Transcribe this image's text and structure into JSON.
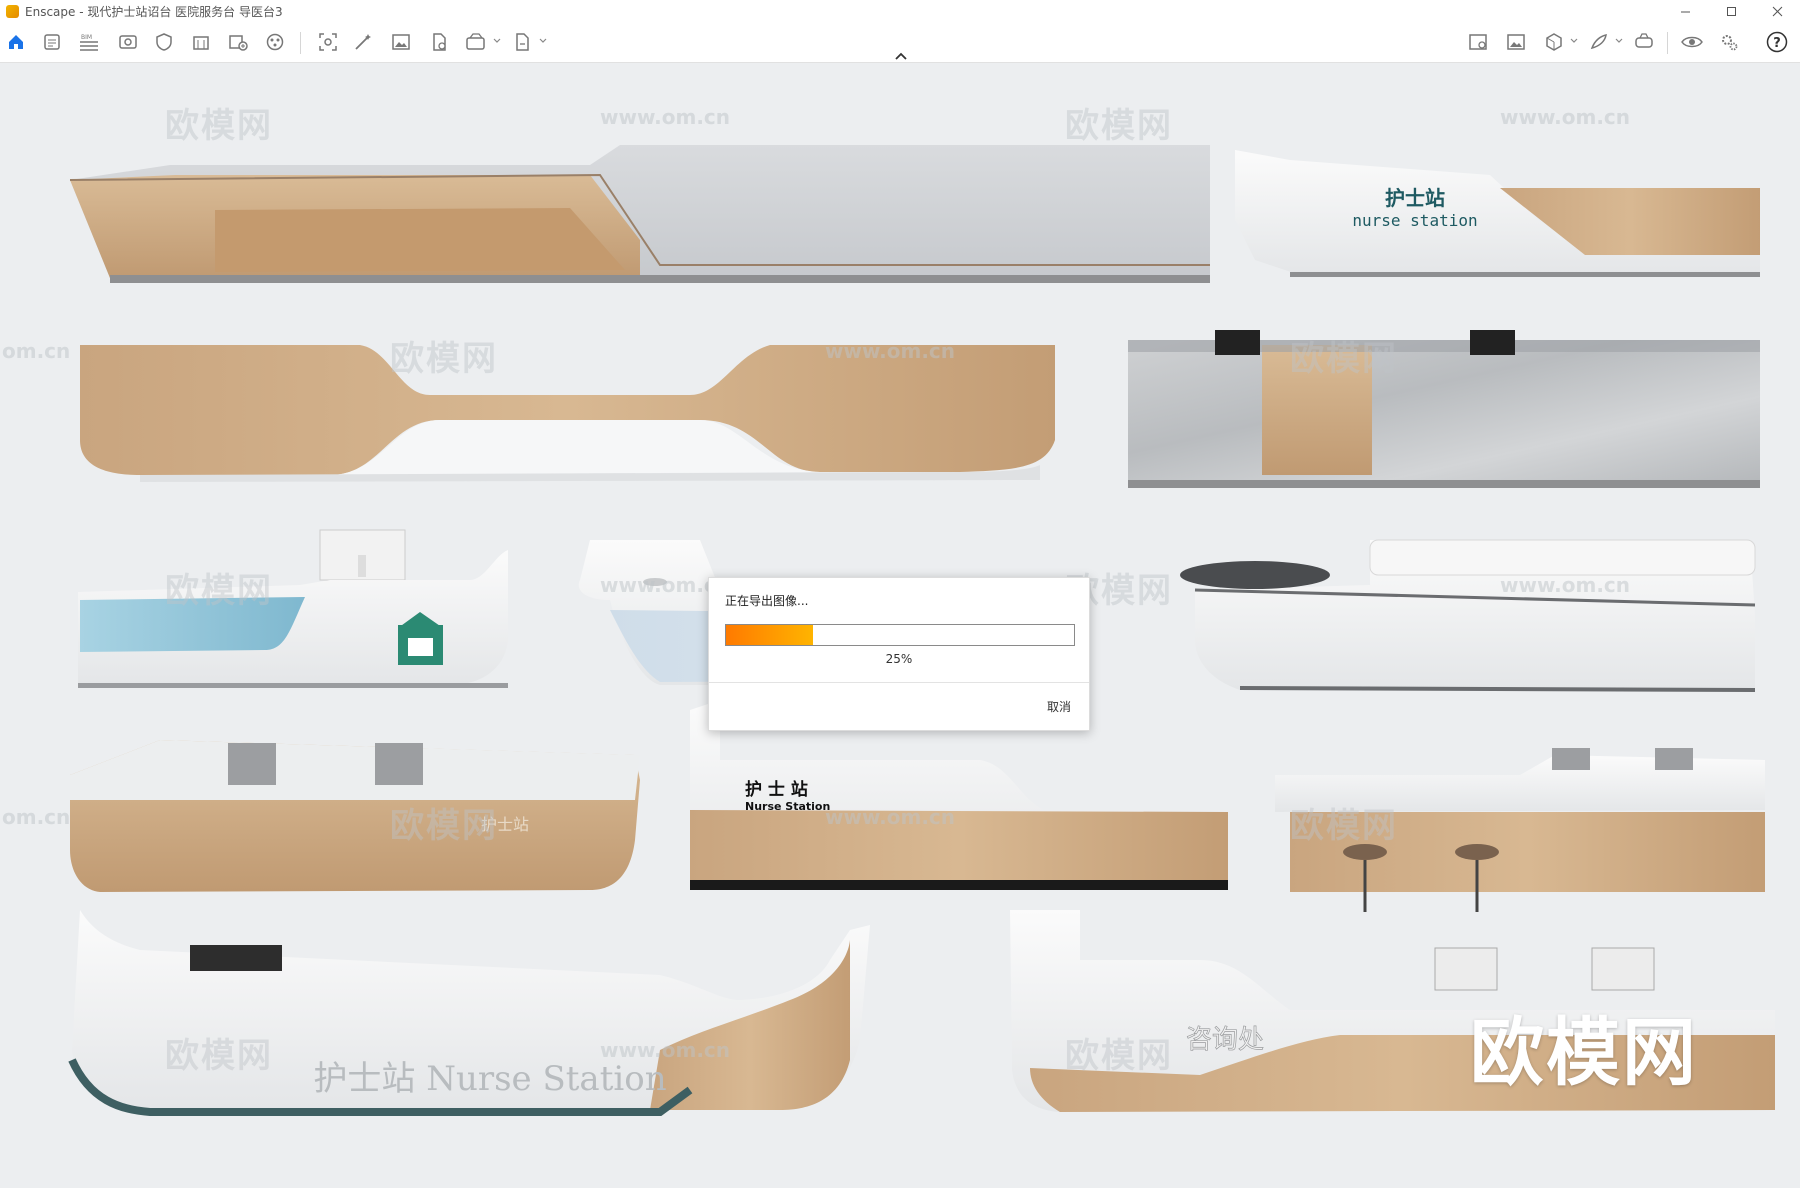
{
  "window": {
    "app_name": "Enscape",
    "title": "Enscape - 现代护士站诏台 医院服务台 导医台3",
    "controls": [
      "minimize",
      "maximize",
      "close"
    ]
  },
  "toolbar": {
    "left_icons": [
      "home-icon",
      "assets-icon",
      "bim-icon",
      "views-icon",
      "safe-frame-icon",
      "building-icon",
      "add-asset-icon",
      "material-icon",
      "screenshot-icon",
      "magic-wand-icon",
      "image-icon",
      "pdf-export-icon",
      "batch-render-icon",
      "export-icon"
    ],
    "right_icons": [
      "map-icon",
      "gallery-icon",
      "cube-icon",
      "sketch-icon",
      "vr-headset-icon",
      "visual-settings-icon",
      "settings-icon",
      "help-icon"
    ]
  },
  "viewport": {
    "watermark_cn": "欧模网",
    "watermark_url": "www.om.cn",
    "watermark_edge": "om.cn",
    "big_watermark": "欧模网",
    "labels": {
      "station_cn": "护士站",
      "station_en": "nurse station",
      "station2_cn": "护 士 站",
      "station2_en": "Nurse  Station",
      "station3": "护士站 Nurse Station",
      "marble_label": "护士站",
      "consult": "咨询处"
    }
  },
  "export_dialog": {
    "title": "正在导出图像...",
    "progress": 0.25,
    "progress_label": "25%",
    "cancel_label": "取消"
  }
}
